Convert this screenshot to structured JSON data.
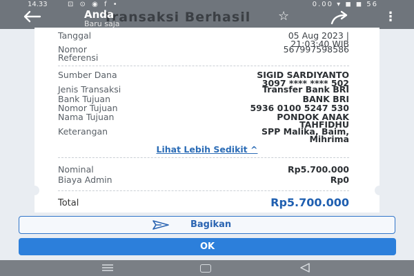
{
  "status_bar": {
    "time": "14.33",
    "icons_left": "⊡ ⊙ ◉ f •",
    "icons_right": "0.00 ▾ ◼ ◼ 56"
  },
  "header": {
    "background_title": "Transaksi Berhasil",
    "sender_name": "Anda",
    "sender_time": "Baru saja",
    "icons": [
      "arrow-left-icon",
      "star-icon",
      "share-icon",
      "more-vert-icon"
    ]
  },
  "receipt": {
    "tanggal_label": "Tanggal",
    "tanggal_line1": "05 Aug 2023 |",
    "tanggal_line2": "21:03:40 WIB",
    "ref_label_line1": "Nomor",
    "ref_label_line2": "Referensi",
    "ref_value": "567997598586",
    "sumber_label": "Sumber Dana",
    "sumber_line1": "SIGID SARDIYANTO",
    "sumber_line2": "3097 **** **** 502",
    "jenis_label": "Jenis Transaksi",
    "jenis_value": "Transfer Bank BRI",
    "bank_label": "Bank Tujuan",
    "bank_value": "BANK BRI",
    "nomor_tujuan_label": "Nomor Tujuan",
    "nomor_tujuan_value": "5936 0100 5247 530",
    "nama_label": "Nama Tujuan",
    "nama_line1": "PONDOK ANAK",
    "nama_line2": "TAHFIDHU",
    "ket_label": "Keterangan",
    "ket_line1": "SPP Malika, Baim,",
    "ket_line2": "Mihrima",
    "toggle_link": "Lihat Lebih Sedikit ^",
    "nominal_label": "Nominal",
    "nominal_value": "Rp5.700.000",
    "admin_label": "Biaya Admin",
    "admin_value": "Rp0",
    "total_label": "Total",
    "total_value": "Rp5.700.000"
  },
  "actions": {
    "share_label": "Bagikan",
    "ok_label": "OK"
  },
  "colors": {
    "accent": "#2c7fdb",
    "link": "#2b6cb6",
    "total": "#1f5fb0"
  }
}
